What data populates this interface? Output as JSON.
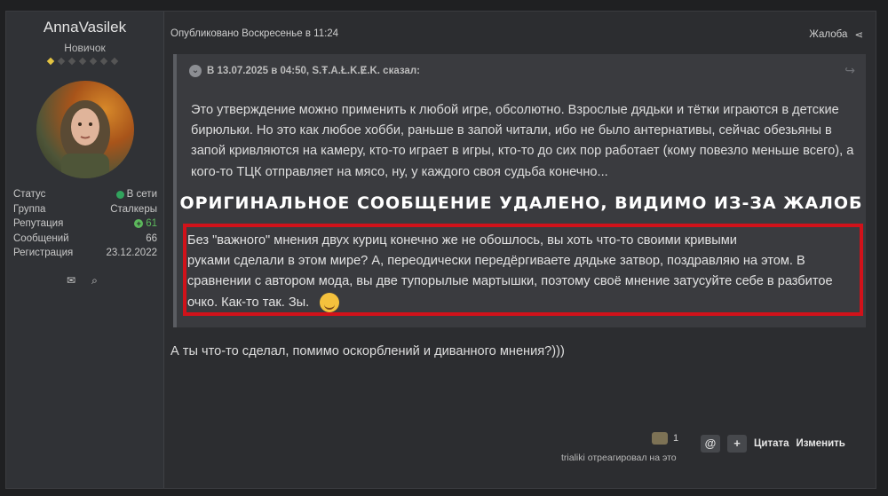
{
  "user": {
    "name": "AnnaVasilek",
    "title": "Новичок",
    "rank_filled": 1,
    "rank_total": 7,
    "stats": [
      {
        "label": "Статус",
        "value": "В сети"
      },
      {
        "label": "Группа",
        "value": "Сталкеры"
      },
      {
        "label": "Репутация",
        "value": "61"
      },
      {
        "label": "Сообщений",
        "value": "66"
      },
      {
        "label": "Регистрация",
        "value": "23.12.2022"
      }
    ]
  },
  "post": {
    "published": "Опубликовано Воскресенье в 11:24",
    "report": "Жалоба",
    "quote_header": "В 13.07.2025 в 04:50, S.Ŧ.A.Ł.K.Ɇ.K. сказал:",
    "quote_text": "Это утверждение можно применить к любой игре, обсолютно. Взрослые дядьки и тётки играются в детские бирюльки. Но это как любое хобби, раньше в запой читали, ибо не было антернативы, сейчас обезьяны в запой кривляются на камеру, кто-то играет в игры, кто-то до сих пор работает (кому повезло меньше всего), а кого-то ТЦК отправляет на мясо, ну, у каждого своя судьба конечно...",
    "removed_banner": "Оригинальное сообщение удалено, видимо из-за жалоб",
    "red_text_line1": "Без \"важного\" мнения двух куриц конечно же не обошлось, вы хоть что-то своими кривыми",
    "red_text_rest": "руками сделали в этом мире? А, переодически  передёргиваете дядьке затвор, поздравляю на этом. В сравнении с автором мода, вы две  тупорылые мартышки, поэтому своё мнение затусуйте себе в разбитое очко. Как-то так. Зы.",
    "reply_text": "А ты что-то сделал, помимо оскорблений и диванного мнения?)))",
    "reaction_count": "1",
    "reaction_note": "trialiki отреагировал на это",
    "quote_btn": "Цитата",
    "edit_btn": "Изменить",
    "mention_icon": "@",
    "plus_icon": "+"
  },
  "colors": {
    "highlight_border": "#d1121a",
    "online": "#31a35d",
    "reputation": "#5cb85c"
  }
}
